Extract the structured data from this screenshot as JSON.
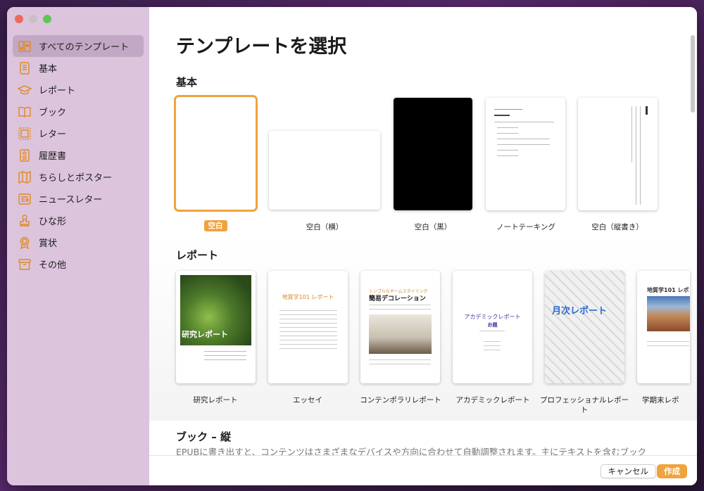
{
  "sidebar": {
    "items": [
      {
        "label": "すべてのテンプレート",
        "icon": "all-templates-icon"
      },
      {
        "label": "基本",
        "icon": "document-icon"
      },
      {
        "label": "レポート",
        "icon": "graduation-cap-icon"
      },
      {
        "label": "ブック",
        "icon": "book-icon"
      },
      {
        "label": "レター",
        "icon": "letter-icon"
      },
      {
        "label": "履歴書",
        "icon": "resume-icon"
      },
      {
        "label": "ちらしとポスター",
        "icon": "map-icon"
      },
      {
        "label": "ニュースレター",
        "icon": "newsletter-icon"
      },
      {
        "label": "ひな形",
        "icon": "stamp-icon"
      },
      {
        "label": "賞状",
        "icon": "award-icon"
      },
      {
        "label": "その他",
        "icon": "archive-icon"
      }
    ],
    "active_index": 0
  },
  "main": {
    "title": "テンプレートを選択",
    "sections": {
      "basic": {
        "title": "基本",
        "templates": [
          "空白",
          "空白（横）",
          "空白（黒）",
          "ノートテーキング",
          "空白（縦書き）"
        ]
      },
      "report": {
        "title": "レポート",
        "templates": [
          "研究レポート",
          "エッセイ",
          "コンテンポラリレポート",
          "アカデミックレポート",
          "プロフェッショナルレポート",
          "学期末レポ"
        ],
        "thumb_text": {
          "research": "研究レポート",
          "essay": "地質学101 レポート",
          "contemporary_sub": "シンプルなホームスタイリング",
          "contemporary": "簡易デコレーション",
          "academic": "アカデミックレポート",
          "academic_sub": "お題",
          "professional": "月次レポート",
          "term": "地質学101 レポ"
        }
      },
      "book": {
        "title": "ブック – 縦",
        "description": "EPUBに書き出すと、コンテンツはさまざまなデバイスや方向に合わせて自動調整されます。主にテキストを含むブック"
      }
    }
  },
  "footer": {
    "cancel_label": "キャンセル",
    "create_label": "作成"
  },
  "colors": {
    "accent": "#f0a33c",
    "sidebar_bg": "#dcc4dd"
  }
}
